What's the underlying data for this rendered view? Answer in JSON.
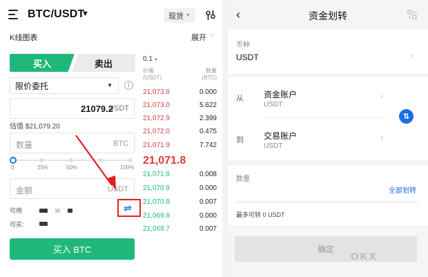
{
  "trade": {
    "pair": "BTC/USDT",
    "market_type": "现货",
    "kline_label": "K线图表",
    "expand_label": "展开",
    "tabs": {
      "buy": "买入",
      "sell": "卖出"
    },
    "order_type": "限价委托",
    "price": {
      "value": "21079.2",
      "unit": "USDT"
    },
    "est_price": "估值 $21,079.20",
    "quantity": {
      "placeholder": "数量",
      "unit": "BTC"
    },
    "slider_labels": [
      "0",
      "25%",
      "50%",
      "100%"
    ],
    "slider_value_percent": 0,
    "amount": {
      "placeholder": "金额",
      "unit": "USDT"
    },
    "available_label": "可用",
    "can_buy_label": "可买:",
    "buy_button": "买入 BTC",
    "transfer_icon": "transfer-arrows-icon"
  },
  "orderbook": {
    "precision": "0.1",
    "price_header": [
      "价格",
      "(USDT)"
    ],
    "qty_header": [
      "数量",
      "(BTC)"
    ],
    "asks": [
      {
        "price": "21,073.8",
        "qty": "0.000"
      },
      {
        "price": "21,073.0",
        "qty": "5.622"
      },
      {
        "price": "21,072.9",
        "qty": "2.399"
      },
      {
        "price": "21,072.0",
        "qty": "0.475"
      },
      {
        "price": "21,071.9",
        "qty": "7.742"
      }
    ],
    "last_price": "21,071.8",
    "bids": [
      {
        "price": "21,071.8",
        "qty": "0.008"
      },
      {
        "price": "21,070.9",
        "qty": "0.000"
      },
      {
        "price": "21,070.8",
        "qty": "0.007"
      },
      {
        "price": "21,069.8",
        "qty": "0.000"
      },
      {
        "price": "21,069.7",
        "qty": "0.007"
      }
    ],
    "colors": {
      "ask": "#d64045",
      "bid": "#1fb87a",
      "last": "#e53935"
    }
  },
  "transfer": {
    "title": "资金划转",
    "coin_label": "币种",
    "coin_value": "USDT",
    "from_label": "从",
    "from_account": "资金账户",
    "from_currency": "USDT",
    "to_label": "到",
    "to_account": "交易账户",
    "to_currency": "USDT",
    "qty_label": "数量",
    "all_button": "全部划转",
    "max_transfer": "最多可转 0 USDT",
    "confirm_button": "确定",
    "watermark": "OKX"
  },
  "colors": {
    "accent_green": "#1fb87a",
    "accent_blue": "#1a6fe8",
    "highlight_red": "#e02020"
  }
}
